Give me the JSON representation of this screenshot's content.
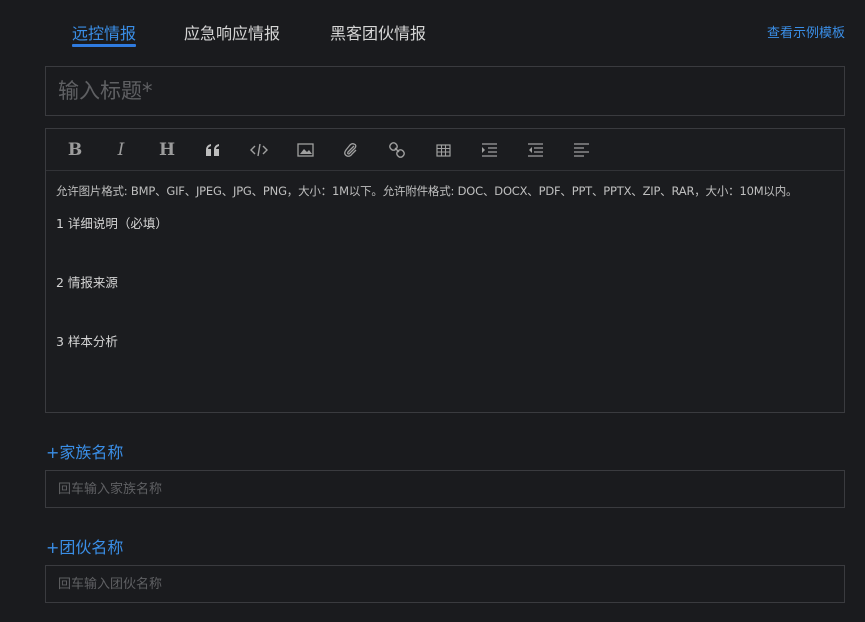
{
  "tabs": [
    {
      "label": "远控情报",
      "active": true
    },
    {
      "label": "应急响应情报",
      "active": false
    },
    {
      "label": "黑客团伙情报",
      "active": false
    }
  ],
  "template_link": "查看示例模板",
  "title": {
    "placeholder": "输入标题*",
    "value": ""
  },
  "toolbar": {
    "bold": "B",
    "italic": "I",
    "heading": "H",
    "icons": [
      "bold-icon",
      "italic-icon",
      "heading-icon",
      "quote-icon",
      "code-icon",
      "image-icon",
      "attachment-icon",
      "link-icon",
      "table-icon",
      "indent-icon",
      "outdent-icon",
      "align-left-icon"
    ]
  },
  "editor": {
    "hint": "允许图片格式: BMP、GIF、JPEG、JPG、PNG，大小：1M以下。允许附件格式: DOC、DOCX、PDF、PPT、PPTX、ZIP、RAR，大小：10M以内。",
    "sections": [
      "1 详细说明（必填）",
      "2 情报来源",
      "3 样本分析"
    ]
  },
  "family": {
    "label": "+家族名称",
    "placeholder": "回车输入家族名称"
  },
  "gang": {
    "label": "+团伙名称",
    "placeholder": "回车输入团伙名称"
  },
  "colors": {
    "accent": "#3a8ee6",
    "background": "#1a1b1e",
    "border": "#3a3b3f"
  }
}
